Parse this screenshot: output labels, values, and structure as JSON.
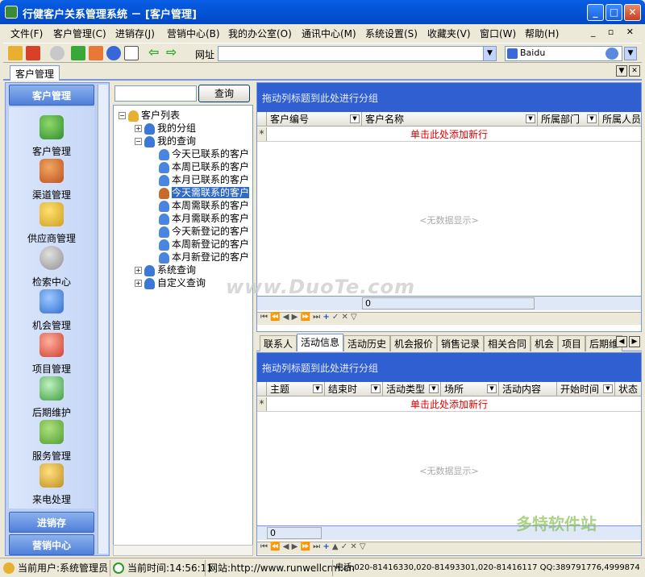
{
  "window": {
    "title": "行健客户关系管理系统 － [客户管理]"
  },
  "menu": [
    "文件(F)",
    "客户管理(C)",
    "进销存(J)",
    "营销中心(B)",
    "我的办公室(O)",
    "通讯中心(M)",
    "系统设置(S)",
    "收藏夹(V)",
    "窗口(W)",
    "帮助(H)"
  ],
  "toolbar": {
    "address_label": "网址",
    "address_value": "",
    "search_engine": "Baidu"
  },
  "doc_tab": "客户管理",
  "leftnav": {
    "header": "客户管理",
    "items": [
      "客户管理",
      "渠道管理",
      "供应商管理",
      "检索中心",
      "机会管理",
      "项目管理",
      "后期维护",
      "服务管理",
      "来电处理"
    ],
    "footer1": "进销存",
    "footer2": "营销中心"
  },
  "tree": {
    "search_placeholder": "",
    "search_button": "查询",
    "root": "客户列表",
    "my_groups": "我的分组",
    "my_queries": "我的查询",
    "children": [
      "今天已联系的客户",
      "本周已联系的客户",
      "本月已联系的客户",
      "今天需联系的客户",
      "本周需联系的客户",
      "本月需联系的客户",
      "今天新登记的客户",
      "本周新登记的客户",
      "本月新登记的客户"
    ],
    "system_query": "系统查询",
    "custom_query": "自定义查询"
  },
  "grid1": {
    "group_hint": "拖动列标题到此处进行分组",
    "columns": [
      "客户编号",
      "客户名称",
      "所属部门",
      "所属人员"
    ],
    "new_row": "单击此处添加新行",
    "empty": "<无数据显示>",
    "footer_value": "0"
  },
  "subtabs": [
    "联系人",
    "活动信息",
    "活动历史",
    "机会报价",
    "销售记录",
    "相关合同",
    "机会",
    "项目",
    "后期维"
  ],
  "grid2": {
    "group_hint": "拖动列标题到此处进行分组",
    "columns": [
      "主题",
      "结束时",
      "活动类型",
      "场所",
      "活动内容",
      "开始时间",
      "状态"
    ],
    "new_row": "单击此处添加新行",
    "empty": "<无数据显示>",
    "footer_value": "0"
  },
  "status": {
    "user": "当前用户:系统管理员",
    "time": "当前时间:14:56:11",
    "site": "网站:http://www.runwellcrm.cn",
    "phone": "电话:020-81416330,020-81493301,020-81416117 QQ:389791776,4999874"
  },
  "watermark": "www.DuoTe.com",
  "logo_watermark": "多特软件站"
}
